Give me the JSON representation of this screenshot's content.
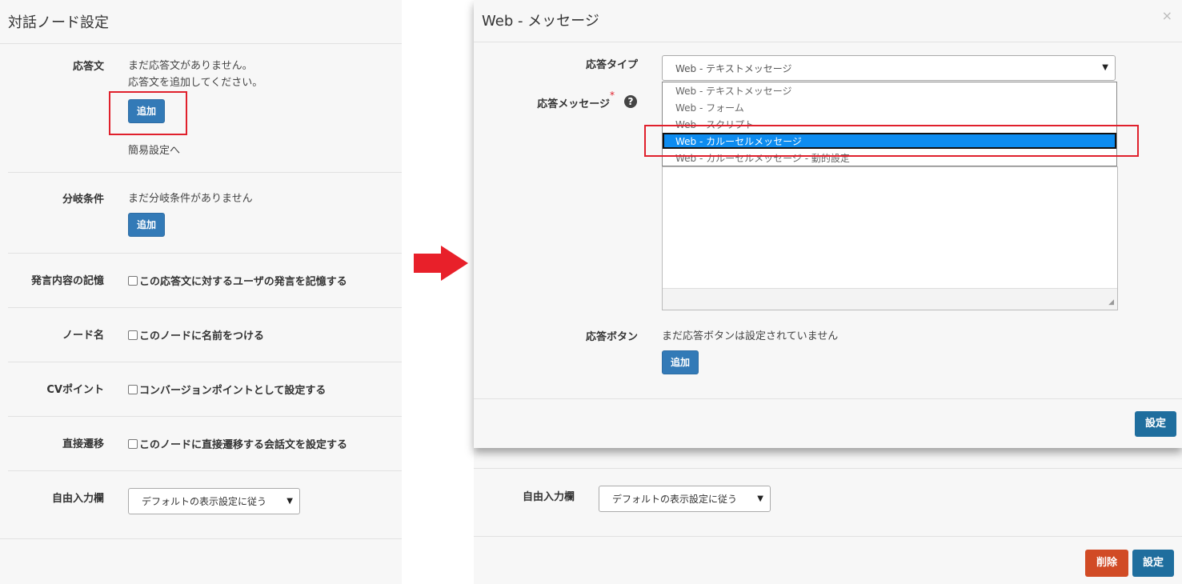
{
  "left_panel": {
    "title": "対話ノード設定",
    "response_text": {
      "label": "応答文",
      "empty_line1": "まだ応答文がありません。",
      "empty_line2": "応答文を追加してください。",
      "add_button": "追加",
      "easy_setup_link": "簡易設定へ"
    },
    "branch_condition": {
      "label": "分岐条件",
      "empty_text": "まだ分岐条件がありません",
      "add_button": "追加"
    },
    "utterance_memory": {
      "label": "発言内容の記憶",
      "checkbox_label": "この応答文に対するユーザの発言を記憶する"
    },
    "node_name": {
      "label": "ノード名",
      "checkbox_label": "このノードに名前をつける"
    },
    "cv_point": {
      "label": "CVポイント",
      "checkbox_label": "コンバージョンポイントとして設定する"
    },
    "direct_transition": {
      "label": "直接遷移",
      "checkbox_label": "このノードに直接遷移する会話文を設定する"
    },
    "free_input": {
      "label": "自由入力欄",
      "selected": "デフォルトの表示設定に従う"
    }
  },
  "modal": {
    "title": "Web - メッセージ",
    "close_symbol": "×",
    "response_type": {
      "label": "応答タイプ",
      "selected": "Web - テキストメッセージ",
      "options": [
        "Web - テキストメッセージ",
        "Web - フォーム",
        "Web - スクリプト",
        "Web - カルーセルメッセージ",
        "Web - カルーセルメッセージ - 動的設定"
      ],
      "highlighted_index": 3
    },
    "response_message": {
      "label": "応答メッセージ",
      "required_mark": "*",
      "help_symbol": "?"
    },
    "response_button": {
      "label": "応答ボタン",
      "empty_text": "まだ応答ボタンは設定されていません",
      "add_button": "追加"
    },
    "set_button": "設定"
  },
  "right_background": {
    "free_input": {
      "label": "自由入力欄",
      "selected": "デフォルトの表示設定に従う"
    },
    "delete_button": "削除",
    "set_button": "設定"
  },
  "colors": {
    "primary_button": "#337ab7",
    "set_button": "#1f6e9e",
    "delete_button": "#d14b25",
    "highlight_box": "#e0202c",
    "selected_option": "#0d8cf0",
    "arrow": "#e8202a"
  }
}
